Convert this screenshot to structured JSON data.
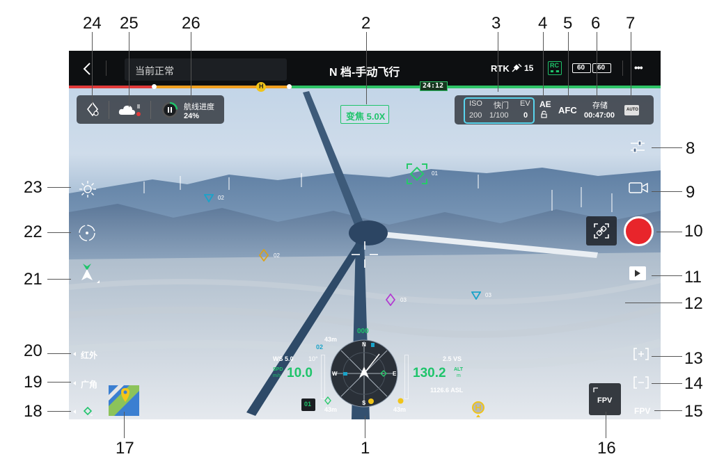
{
  "topbar": {
    "status_text": "当前正常",
    "mode_title": "N 档-手动飞行",
    "rtk_label": "RTK",
    "satellite_count": "15",
    "rc_label": "RC",
    "battery_left": "60",
    "battery_right": "60",
    "more_label": "•••"
  },
  "statusline": {
    "home_marker": "H",
    "time_remaining": "24:12"
  },
  "left_panel": {
    "route_progress_label": "航线进度",
    "route_progress_value": "24%",
    "route_progress_fraction": 0.24
  },
  "camera": {
    "zoom_label": "变焦 5.0X",
    "iso_label": "ISO",
    "iso_value": "200",
    "shutter_label": "快门",
    "shutter_value": "1/100",
    "ev_label": "EV",
    "ev_value": "0",
    "ae_label": "AE",
    "focus_label": "AFC",
    "storage_label": "存储",
    "storage_value": "00:47:00",
    "auto_label": "AUTO"
  },
  "waypoints": [
    {
      "label": "01",
      "color": "#27c96a",
      "shape": "square-diamond"
    },
    {
      "label": "02",
      "color": "#1aa3c9",
      "shape": "triangle"
    },
    {
      "label": "02",
      "color": "#d9a21a",
      "shape": "diamond"
    },
    {
      "label": "03",
      "color": "#b23bd1",
      "shape": "diamond"
    },
    {
      "label": "03",
      "color": "#1aa3c9",
      "shape": "triangle"
    }
  ],
  "left_rail": {
    "infrared_label": "红外",
    "wide_label": "广角"
  },
  "right_rail": {
    "fpv_label": "FPV",
    "fpv_button_label": "FPV"
  },
  "navigation": {
    "heading_value": "000",
    "north_label": "N",
    "east_label": "E",
    "south_label": "S",
    "west_label": "W",
    "ws_text": "WS 5.0",
    "ws_dir": "10°",
    "top_dist": "43m",
    "top_wp_label": "02",
    "spd_label": "SPD",
    "spd_unit": "m/s",
    "spd_value": "10.0",
    "alt_label": "ALT",
    "alt_unit": "m",
    "alt_value": "130.2",
    "vs_text": "2.5 VS",
    "asl_text": "1126.6 ASL",
    "bottom_left_dist": "43m",
    "bottom_right_dist": "43m",
    "waypoint_chip": "01"
  },
  "callouts": [
    "1",
    "2",
    "3",
    "4",
    "5",
    "6",
    "7",
    "8",
    "9",
    "10",
    "11",
    "12",
    "13",
    "14",
    "15",
    "16",
    "17",
    "18",
    "19",
    "20",
    "21",
    "22",
    "23",
    "24",
    "25",
    "26"
  ],
  "colors": {
    "record": "#e8252b",
    "accent_green": "#1fc46b",
    "cyan_border": "#59d5ee",
    "warning_yellow": "#f0c419",
    "status_red": "#e23a3a",
    "status_orange": "#f0a020",
    "status_green": "#2ec467"
  }
}
